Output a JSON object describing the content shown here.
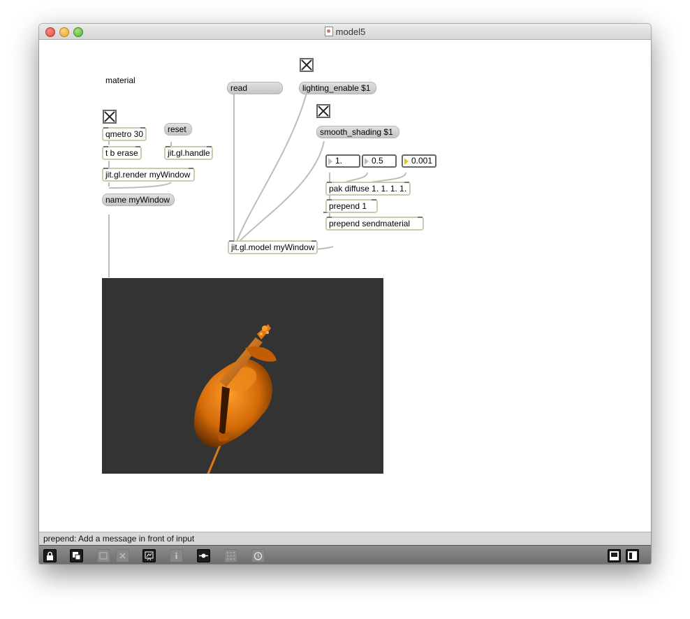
{
  "window": {
    "title": "model5"
  },
  "patcher": {
    "comment_material": "material",
    "msg_read": "read",
    "msg_lighting": "lighting_enable $1",
    "msg_smooth": "smooth_shading $1",
    "msg_reset": "reset",
    "msg_name": "name myWindow",
    "obj_qmetro": "qmetro 30",
    "obj_trigger": "t b erase",
    "obj_handle": "jit.gl.handle",
    "obj_render": "jit.gl.render myWindow",
    "obj_pak": "pak diffuse 1. 1. 1. 1.",
    "obj_prepend1": "prepend 1",
    "obj_prepend_send": "prepend sendmaterial",
    "obj_model": "jit.gl.model myWindow",
    "float1": "1.",
    "float2": "0.5",
    "float3": "0.001"
  },
  "status_bar": {
    "text": "prepend: Add a message in front of input"
  },
  "toolbar": {
    "icons": [
      "lock-icon",
      "presentation-icon",
      "new-object-icon",
      "delete-icon",
      "debug-icon",
      "inspector-icon",
      "connection-icon",
      "grid-icon",
      "clue-icon",
      "split-horizontal-icon",
      "split-vertical-icon"
    ]
  },
  "colors": {
    "render_bg": "#333333",
    "model": "#e07a10",
    "object_border": "#c5cfb0"
  }
}
